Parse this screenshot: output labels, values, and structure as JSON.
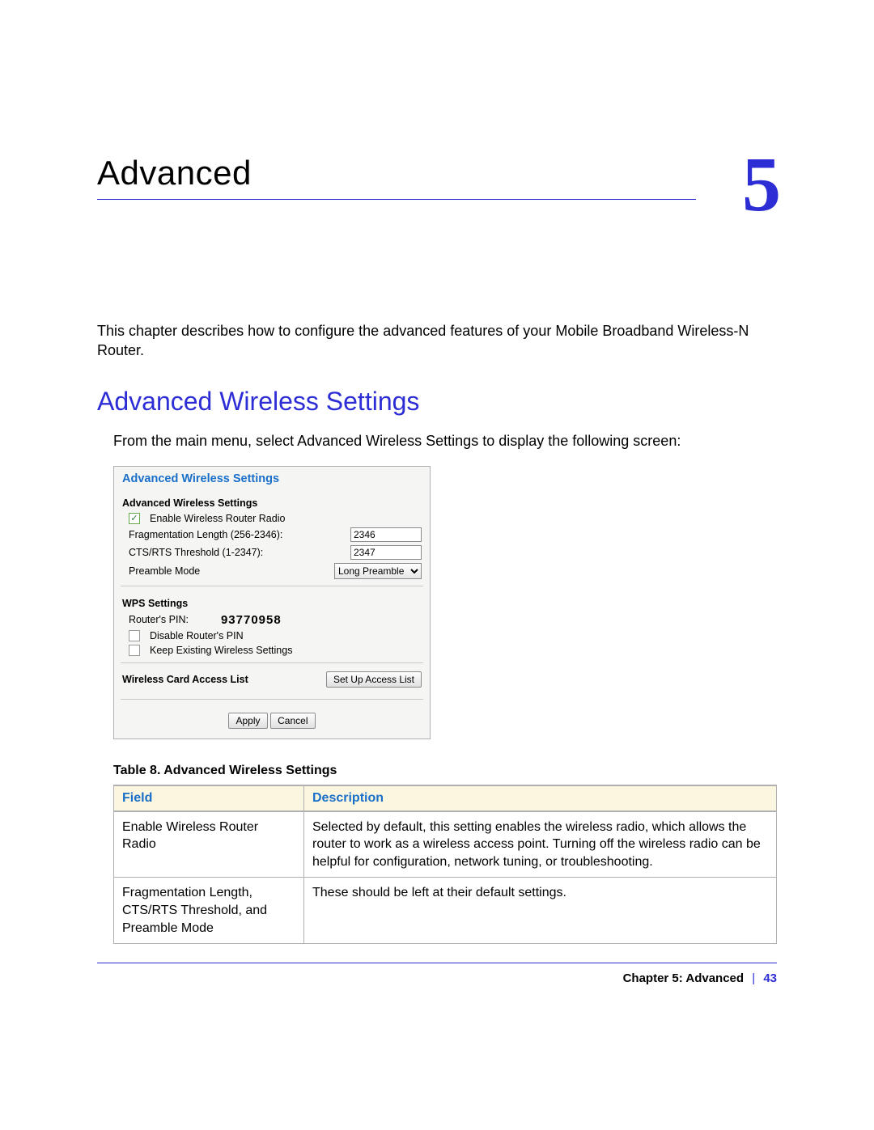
{
  "chapter": {
    "title": "Advanced",
    "number": "5"
  },
  "intro": "This chapter describes how to configure the advanced features of your Mobile Broadband Wireless-N Router.",
  "section_heading": "Advanced Wireless Settings",
  "section_intro": "From the main menu, select Advanced Wireless Settings to display the following screen:",
  "screenshot": {
    "panel_title": "Advanced Wireless Settings",
    "group1_title": "Advanced Wireless Settings",
    "enable_radio_label": "Enable Wireless Router Radio",
    "enable_radio_checked": true,
    "frag_label": "Fragmentation Length (256-2346):",
    "frag_value": "2346",
    "ctsrts_label": "CTS/RTS Threshold (1-2347):",
    "ctsrts_value": "2347",
    "preamble_label": "Preamble Mode",
    "preamble_value": "Long Preamble",
    "group2_title": "WPS Settings",
    "router_pin_label": "Router's PIN:",
    "router_pin_value": "93770958",
    "disable_pin_label": "Disable Router's PIN",
    "disable_pin_checked": false,
    "keep_existing_label": "Keep Existing Wireless Settings",
    "keep_existing_checked": false,
    "group3_title": "Wireless Card Access List",
    "access_list_btn": "Set Up Access List",
    "apply_btn": "Apply",
    "cancel_btn": "Cancel"
  },
  "table": {
    "caption": "Table 8.  Advanced Wireless Settings",
    "headers": [
      "Field",
      "Description"
    ],
    "rows": [
      {
        "field": "Enable Wireless Router Radio",
        "desc": "Selected by default, this setting enables the wireless radio, which allows the router to work as a wireless access point.\nTurning off the wireless radio can be helpful for configuration, network tuning, or troubleshooting."
      },
      {
        "field": "Fragmentation Length, CTS/RTS Threshold, and Preamble Mode",
        "desc": "These should be left at their default settings."
      }
    ]
  },
  "footer": {
    "chapter_label": "Chapter 5:  Advanced",
    "page": "43"
  }
}
